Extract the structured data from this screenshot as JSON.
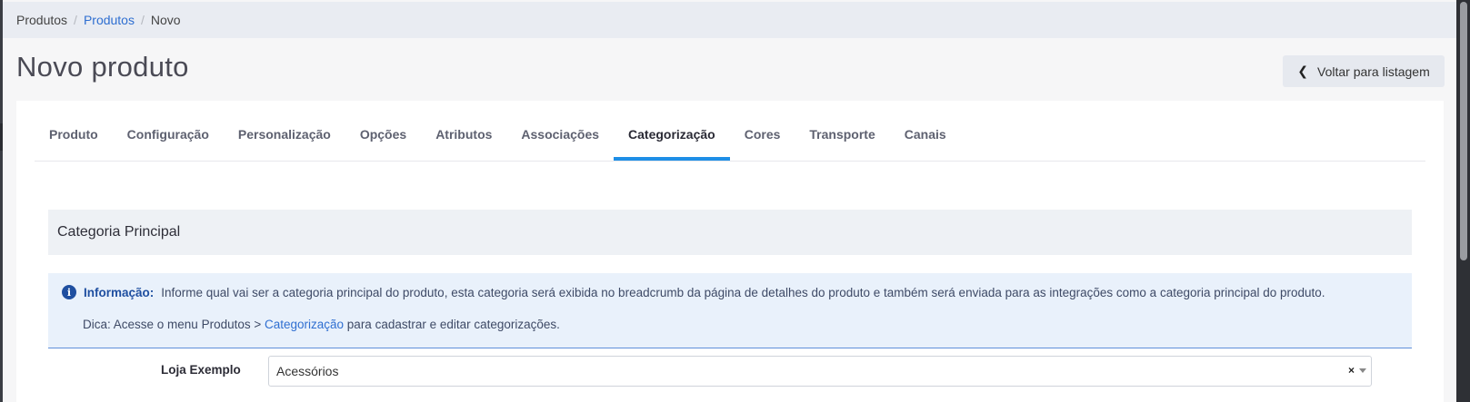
{
  "breadcrumb": {
    "items": [
      "Produtos",
      "Produtos",
      "Novo"
    ],
    "separator": "/"
  },
  "header": {
    "title": "Novo produto",
    "back_label": "Voltar para listagem"
  },
  "tabs": [
    {
      "label": "Produto",
      "active": false
    },
    {
      "label": "Configuração",
      "active": false
    },
    {
      "label": "Personalização",
      "active": false
    },
    {
      "label": "Opções",
      "active": false
    },
    {
      "label": "Atributos",
      "active": false
    },
    {
      "label": "Associações",
      "active": false
    },
    {
      "label": "Categorização",
      "active": true
    },
    {
      "label": "Cores",
      "active": false
    },
    {
      "label": "Transporte",
      "active": false
    },
    {
      "label": "Canais",
      "active": false
    }
  ],
  "section": {
    "title": "Categoria Principal"
  },
  "info": {
    "icon": "info-icon",
    "label": "Informação:",
    "message": "Informe qual vai ser a categoria principal do produto, esta categoria será exibida no breadcrumb da página de detalhes do produto e também será enviada para as integrações como a categoria principal do produto.",
    "tip_prefix": "Dica: Acesse o menu Produtos > ",
    "tip_link": "Categorização",
    "tip_suffix": " para cadastrar e editar categorizações."
  },
  "form": {
    "store_label": "Loja Exemplo",
    "category_value": "Acessórios",
    "clear_symbol": "×"
  },
  "colors": {
    "accent": "#1e8ee6",
    "link": "#2f6fd1",
    "info_bg": "#e9f1fb",
    "info_icon": "#1f4fa0"
  }
}
